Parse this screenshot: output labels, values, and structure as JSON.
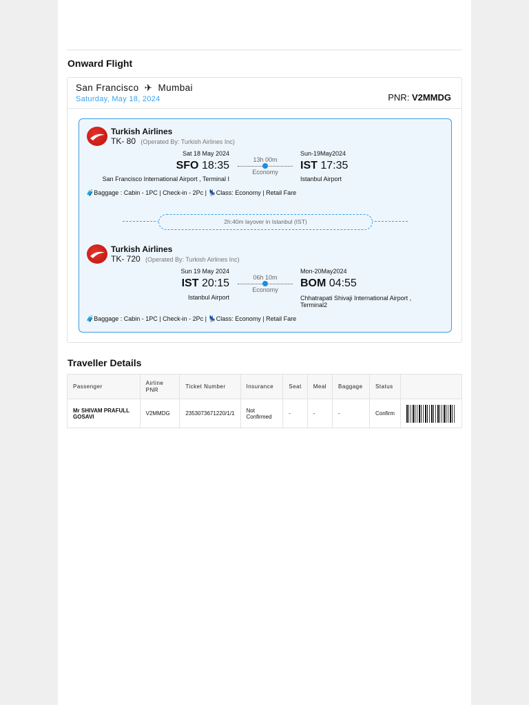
{
  "onward_title": "Onward Flight",
  "route": {
    "from": "San Francisco",
    "to": "Mumbai",
    "date": "Saturday, May 18, 2024",
    "pnr_label": "PNR:",
    "pnr": "V2MMDG"
  },
  "segments": [
    {
      "airline": "Turkish Airlines",
      "flight": "TK- 80",
      "operated": "(Operated By: Turkish Airlines Inc)",
      "dep_date": "Sat 18 May 2024",
      "dep_code": "SFO",
      "dep_time": "18:35",
      "dep_airport": "San Francisco International Airport , Terminal I",
      "duration": "13h 00m",
      "cabin": "Economy",
      "arr_date": "Sun-19May2024",
      "arr_code": "IST",
      "arr_time": "17:35",
      "arr_airport": "Istanbul Airport",
      "baggage": "Baggage : Cabin - 1PC | Check-in - 2Pc |",
      "class": "Class: Economy | Retail Fare"
    },
    {
      "airline": "Turkish Airlines",
      "flight": "TK- 720",
      "operated": "(Operated By: Turkish Airlines Inc)",
      "dep_date": "Sun 19 May 2024",
      "dep_code": "IST",
      "dep_time": "20:15",
      "dep_airport": "Istanbul Airport",
      "duration": "06h 10m",
      "cabin": "Economy",
      "arr_date": "Mon-20May2024",
      "arr_code": "BOM",
      "arr_time": "04:55",
      "arr_airport": "Chhatrapati Shivaji International Airport , Terminal2",
      "baggage": "Baggage : Cabin - 1PC | Check-in - 2Pc |",
      "class": "Class: Economy | Retail Fare"
    }
  ],
  "layover": "2h:40m layover in Istanbul (IST)",
  "traveller_title": "Traveller Details",
  "table": {
    "headers": [
      "Passenger",
      "Airline PNR",
      "Ticket Number",
      "Insurance",
      "Seat",
      "Meal",
      "Baggage",
      "Status",
      ""
    ],
    "rows": [
      [
        "Mr SHIVAM PRAFULL GOSAVI",
        "V2MMDG",
        "2353073671220/1/1",
        "Not Confirmed",
        "-",
        "-",
        "-",
        "Confirm"
      ]
    ]
  },
  "colors": {
    "accent": "#1d8de0",
    "box_bg": "#eef6fd",
    "brand_red": "#d8241e"
  }
}
